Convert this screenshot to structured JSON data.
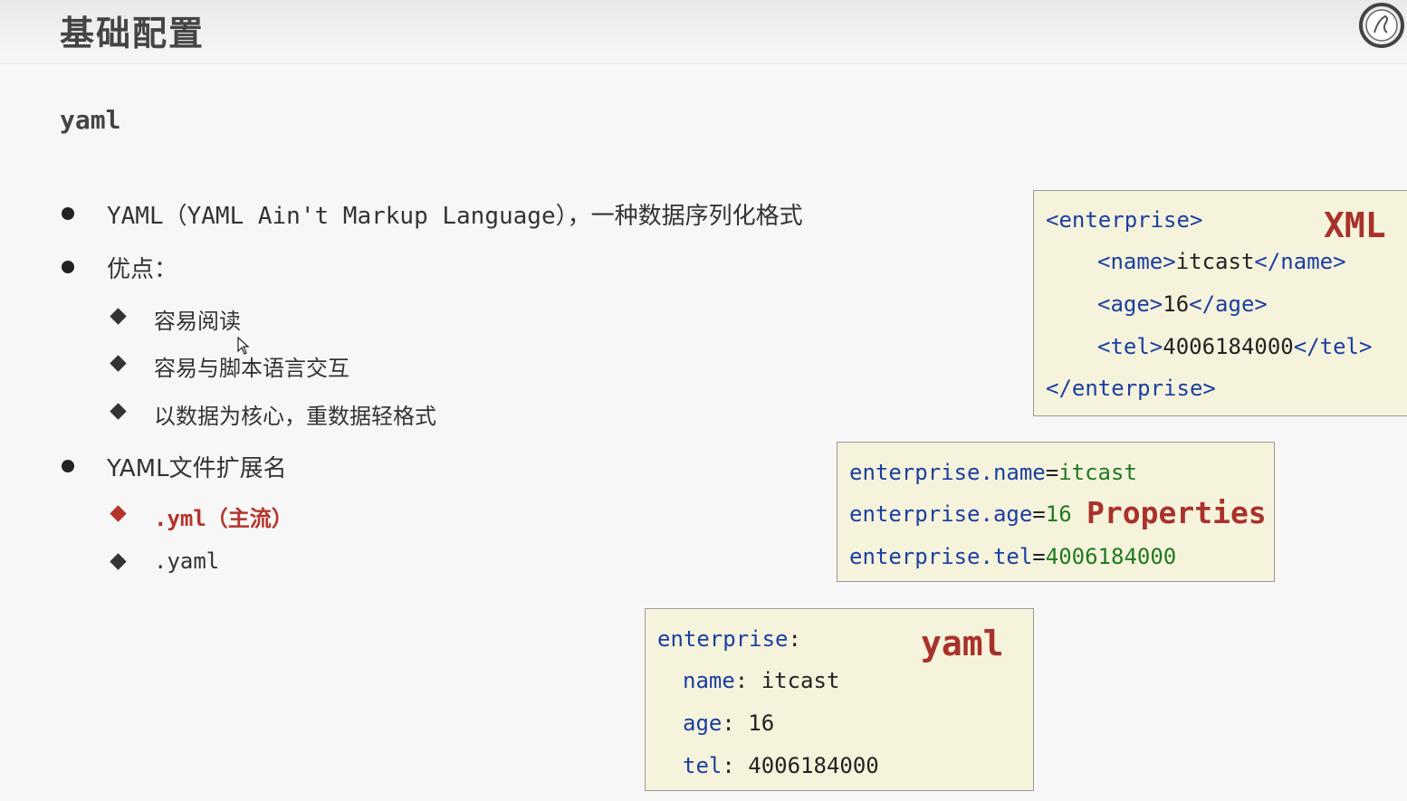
{
  "header": {
    "title": "基础配置"
  },
  "subtitle": "yaml",
  "bullets": {
    "b1": "YAML（YAML Ain't Markup Language），一种数据序列化格式",
    "b2": "优点：",
    "b2_items": [
      "容易阅读",
      "容易与脚本语言交互",
      "以数据为核心，重数据轻格式"
    ],
    "b3": "YAML文件扩展名",
    "b3_items": [
      ".yml（主流）",
      ".yaml"
    ]
  },
  "xml_box": {
    "label": "XML",
    "lines": {
      "l1_tag": "<enterprise>",
      "l2_open": "<name>",
      "l2_val": "itcast",
      "l2_close": "</name>",
      "l3_open": "<age>",
      "l3_val": "16",
      "l3_close": "</age>",
      "l4_open": "<tel>",
      "l4_val": "4006184000",
      "l4_close": "</tel>",
      "l5_tag": "</enterprise>"
    }
  },
  "properties_box": {
    "label": "Properties",
    "lines": [
      {
        "key": "enterprise.name",
        "eq": "=",
        "value": "itcast"
      },
      {
        "key": "enterprise.age",
        "eq": "=",
        "value": "16"
      },
      {
        "key": "enterprise.tel",
        "eq": "=",
        "value": "4006184000"
      }
    ]
  },
  "yaml_box": {
    "label": "yaml",
    "root_key": "enterprise",
    "colon": ":",
    "entries": [
      {
        "key": "name",
        "value": " itcast"
      },
      {
        "key": "age",
        "value": " 16"
      },
      {
        "key": "tel",
        "value": " 4006184000"
      }
    ]
  },
  "icons": {
    "logo": "circular-logo-icon",
    "cursor": "mouse-pointer-icon"
  }
}
